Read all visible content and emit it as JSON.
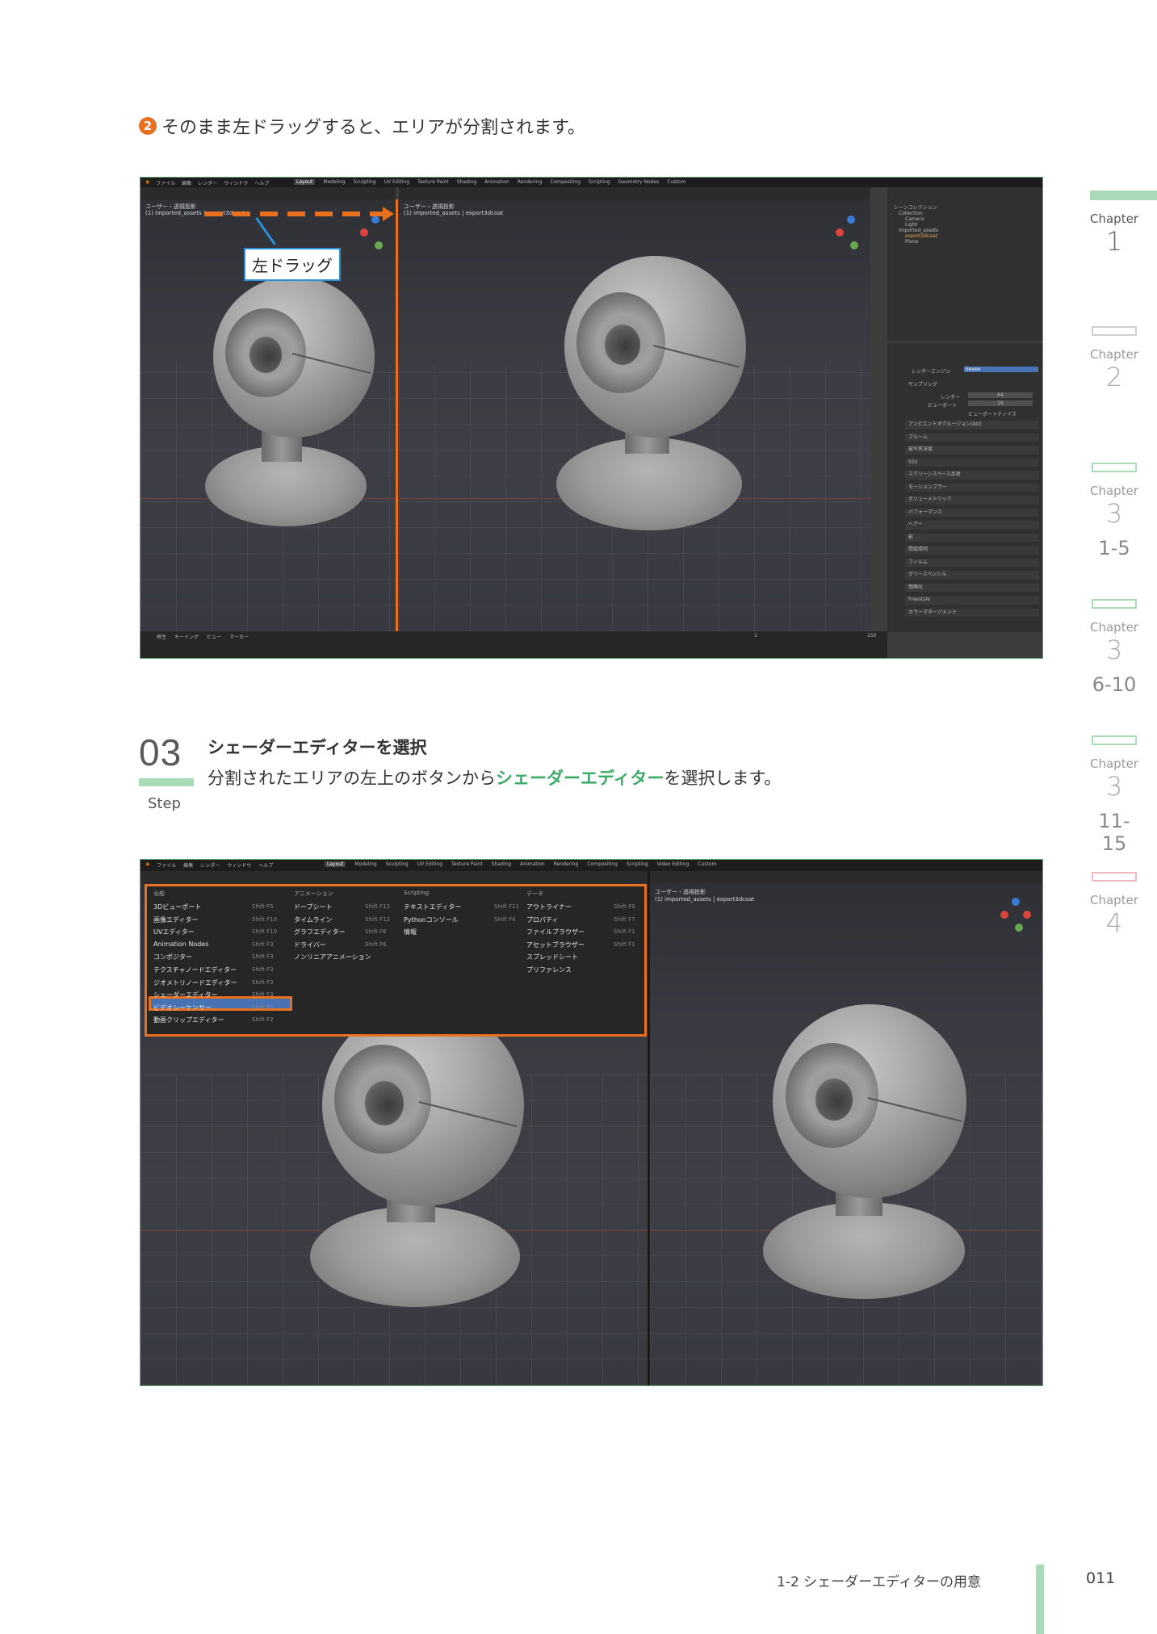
{
  "caption1": {
    "badge": "2",
    "text": "そのまま左ドラッグすると、エリアが分割されます。"
  },
  "shot1": {
    "menu": [
      "ファイル",
      "編集",
      "レンダー",
      "ウィンドウ",
      "ヘルプ"
    ],
    "workspaces": [
      "Layout",
      "Modeling",
      "Sculpting",
      "UV Editing",
      "Texture Paint",
      "Shading",
      "Animation",
      "Rendering",
      "Compositing",
      "Scripting",
      "Geometry Nodes",
      "Custom"
    ],
    "view_label": "ユーザー・透視投影",
    "collection_label": "(1) imported_assets | export3dcoat",
    "callout": "左ドラッグ",
    "timeline": [
      "再生",
      "キーイング",
      "ビュー",
      "マーカー"
    ],
    "frame_start": "1",
    "frame_end": "150",
    "render_engine": "Eevee",
    "props_title": "レンダーエンジン",
    "sampling": "サンプリング",
    "render_label": "レンダー",
    "render_val": "64",
    "viewport_label": "ビューポート",
    "viewport_val": "16",
    "denoise": "ビューポートデノイズ",
    "panels": [
      "アンビエントオクルージョン(AO)",
      "ブルーム",
      "被写界深度",
      "SSS",
      "スクリーンスペース反射",
      "モーションブラー",
      "ボリューメトリック",
      "パフォーマンス",
      "ヘアー",
      "影",
      "間接照明",
      "フィルム",
      "グリースペンシル",
      "簡略化",
      "Freestyle",
      "カラーマネージメント"
    ],
    "outliner": [
      "シーンコレクション",
      "Collection",
      "Camera",
      "Light",
      "imported_assets",
      "export3dcoat",
      "Plane"
    ]
  },
  "step": {
    "number": "03",
    "label": "Step",
    "title": "シェーダーエディターを選択",
    "desc_before": "分割されたエリアの左上のボタンから",
    "desc_highlight": "シェーダーエディター",
    "desc_after": "を選択します。"
  },
  "shot2": {
    "menu": [
      "ファイル",
      "編集",
      "レンダー",
      "ウィンドウ",
      "ヘルプ"
    ],
    "workspaces": [
      "Layout",
      "Modeling",
      "Sculpting",
      "UV Editing",
      "Texture Paint",
      "Shading",
      "Animation",
      "Rendering",
      "Compositing",
      "Scripting",
      "Video Editing",
      "Custom"
    ],
    "view_label": "ユーザー・透視投影",
    "collection_label": "(1) imported_assets | export3dcoat",
    "editor_menu": {
      "col_general": "全般",
      "col_anim": "アニメーション",
      "col_script": "Scripting",
      "col_data": "データ",
      "general": [
        {
          "label": "3Dビューポート",
          "sc": "Shift F5"
        },
        {
          "label": "画像エディター",
          "sc": "Shift F10"
        },
        {
          "label": "UVエディター",
          "sc": "Shift F10"
        },
        {
          "label": "Animation Nodes",
          "sc": "Shift F3"
        },
        {
          "label": "コンポジター",
          "sc": "Shift F3"
        },
        {
          "label": "テクスチャノードエディター",
          "sc": "Shift F3"
        },
        {
          "label": "ジオメトリノードエディター",
          "sc": "Shift F3"
        },
        {
          "label": "シェーダーエディター",
          "sc": "Shift F3"
        },
        {
          "label": "ビデオシーケンサー",
          "sc": "Shift F8"
        },
        {
          "label": "動画クリップエディター",
          "sc": "Shift F2"
        }
      ],
      "anim": [
        {
          "label": "ドープシート",
          "sc": "Shift F12"
        },
        {
          "label": "タイムライン",
          "sc": "Shift F12"
        },
        {
          "label": "グラフエディター",
          "sc": "Shift F6"
        },
        {
          "label": "ドライバー",
          "sc": "Shift F6"
        },
        {
          "label": "ノンリニアアニメーション",
          "sc": ""
        }
      ],
      "script": [
        {
          "label": "テキストエディター",
          "sc": "Shift F11"
        },
        {
          "label": "Pythonコンソール",
          "sc": "Shift F4"
        },
        {
          "label": "情報",
          "sc": ""
        }
      ],
      "data": [
        {
          "label": "アウトライナー",
          "sc": "Shift F9"
        },
        {
          "label": "プロパティ",
          "sc": "Shift F7"
        },
        {
          "label": "ファイルブラウザー",
          "sc": "Shift F1"
        },
        {
          "label": "アセットブラウザー",
          "sc": "Shift F1"
        },
        {
          "label": "スプレッドシート",
          "sc": ""
        },
        {
          "label": "プリファレンス",
          "sc": ""
        }
      ]
    }
  },
  "chapters": [
    {
      "label": "Chapter",
      "num": "1",
      "range": "",
      "color": "#a9dbb8",
      "filled": true
    },
    {
      "label": "Chapter",
      "num": "2",
      "range": "",
      "color": "#cfcfcf",
      "filled": false
    },
    {
      "label": "Chapter",
      "num": "3",
      "range": "1-5",
      "color": "#a9dbb8",
      "filled": false
    },
    {
      "label": "Chapter",
      "num": "3",
      "range": "6-10",
      "color": "#a9dbb8",
      "filled": false
    },
    {
      "label": "Chapter",
      "num": "3",
      "range": "11-15",
      "color": "#a9dbb8",
      "filled": false
    },
    {
      "label": "Chapter",
      "num": "4",
      "range": "",
      "color": "#f2b8c2",
      "filled": false
    }
  ],
  "footer": {
    "section": "1-2 シェーダーエディターの用意",
    "page": "011"
  }
}
